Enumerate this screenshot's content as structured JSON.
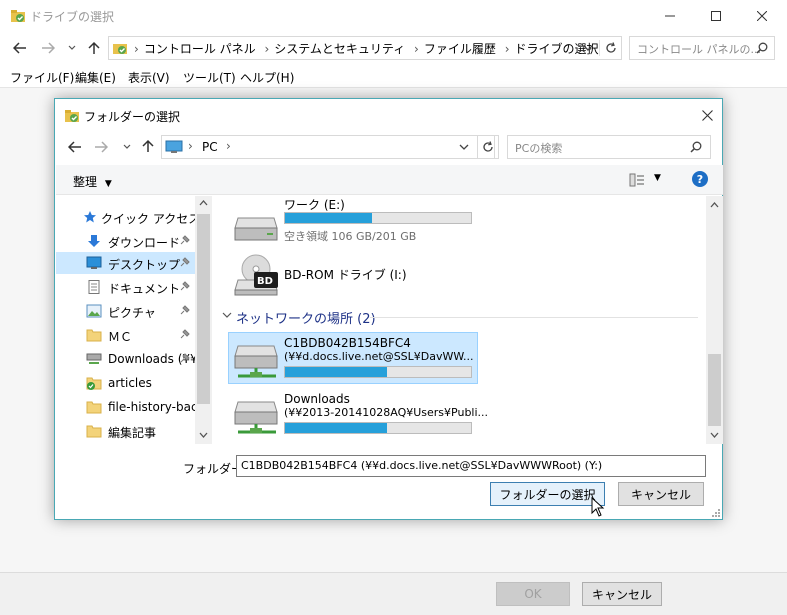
{
  "window": {
    "title": "ドライブの選択",
    "minimize_label": "—",
    "maximize_label": "☐",
    "close_label": "✕"
  },
  "main_address": {
    "crumbs": [
      "コントロール パネル",
      "システムとセキュリティ",
      "ファイル履歴",
      "ドライブの選択"
    ],
    "search_placeholder": "コントロール パネルの..."
  },
  "menu": {
    "items": [
      "ファイル(F)",
      "編集(E)",
      "表示(V)",
      "ツール(T)",
      "ヘルプ(H)"
    ]
  },
  "bottom": {
    "ok_label": "OK",
    "cancel_label": "キャンセル"
  },
  "dialog": {
    "title": "フォルダーの選択",
    "address": "PC",
    "search_placeholder": "PCの検索",
    "organize_label": "整理",
    "help_label": "?",
    "nav": [
      {
        "label": "クイック アクセス",
        "icon": "star-icon"
      },
      {
        "label": "ダウンロード",
        "icon": "download-icon",
        "pinned": true
      },
      {
        "label": "デスクトップ",
        "icon": "desktop-icon",
        "pinned": true,
        "selected": true
      },
      {
        "label": "ドキュメント",
        "icon": "document-icon",
        "pinned": true
      },
      {
        "label": "ピクチャ",
        "icon": "picture-icon",
        "pinned": true
      },
      {
        "label": "ＭＣ",
        "icon": "folder-icon",
        "pinned": true
      },
      {
        "label": "Downloads (¥¥d",
        "icon": "network-drive-icon",
        "pinned": true
      },
      {
        "label": "articles",
        "icon": "folder-sync-icon"
      },
      {
        "label": "file-history-back",
        "icon": "folder-icon"
      },
      {
        "label": "編集記事",
        "icon": "folder-icon"
      }
    ],
    "drives": [
      {
        "name": "ワーク (E:)",
        "free": "空き領域 106 GB/201 GB",
        "used_fraction": 0.47
      },
      {
        "name": "BD-ROM ドライブ (I:)",
        "badge": "BD"
      }
    ],
    "network_group": "ネットワークの場所 (2)",
    "network_drives": [
      {
        "name": "C1BDB042B154BFC4",
        "path": "(¥¥d.docs.live.net@SSL¥DavWW...",
        "used_fraction": 0.55,
        "selected": true
      },
      {
        "name": "Downloads",
        "path": "(¥¥2013-20141028AQ¥Users¥Publi...",
        "used_fraction": 0.55
      }
    ],
    "folder_label": "フォルダー:",
    "folder_value": "C1BDB042B154BFC4 (¥¥d.docs.live.net@SSL¥DavWWWRoot) (Y:)",
    "select_label": "フォルダーの選択",
    "cancel_label": "キャンセル"
  }
}
